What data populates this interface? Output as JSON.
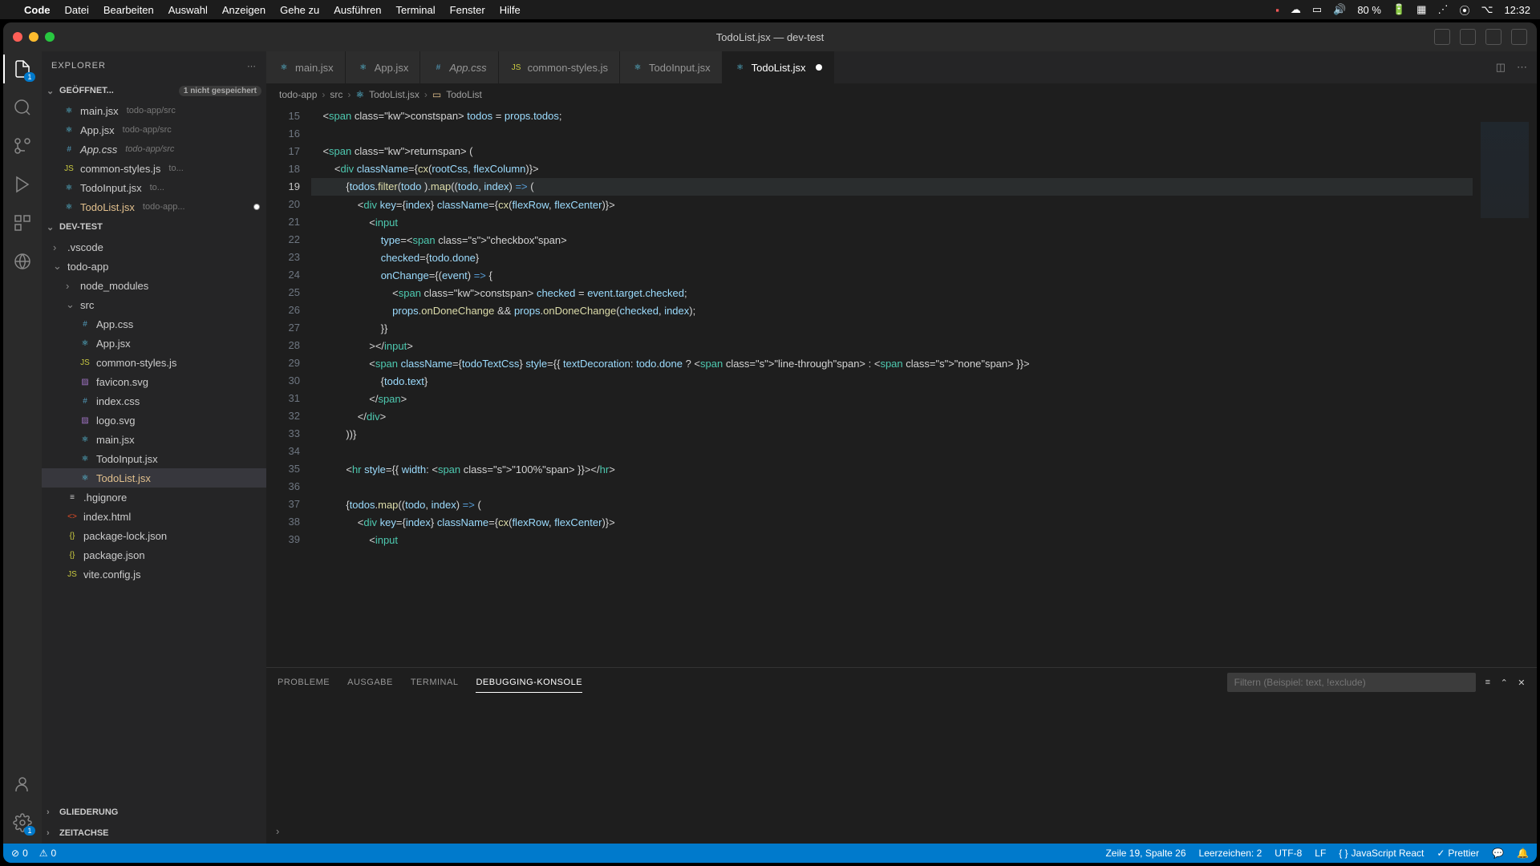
{
  "menubar": {
    "app": "Code",
    "items": [
      "Datei",
      "Bearbeiten",
      "Auswahl",
      "Anzeigen",
      "Gehe zu",
      "Ausführen",
      "Terminal",
      "Fenster",
      "Hilfe"
    ],
    "battery": "80 %",
    "time": "12:32"
  },
  "window": {
    "title": "TodoList.jsx — dev-test"
  },
  "sidebar": {
    "title": "EXPLORER",
    "openEditors": {
      "label": "GEÖFFNET...",
      "badge": "1 nicht gespeichert",
      "items": [
        {
          "name": "main.jsx",
          "path": "todo-app/src",
          "icon": "react"
        },
        {
          "name": "App.jsx",
          "path": "todo-app/src",
          "icon": "react"
        },
        {
          "name": "App.css",
          "path": "todo-app/src",
          "icon": "css",
          "italic": true
        },
        {
          "name": "common-styles.js",
          "path": "to...",
          "icon": "js"
        },
        {
          "name": "TodoInput.jsx",
          "path": "to...",
          "icon": "react"
        },
        {
          "name": "TodoList.jsx",
          "path": "todo-app...",
          "icon": "react",
          "modified": true
        }
      ]
    },
    "workspace": {
      "label": "DEV-TEST",
      "tree": [
        {
          "name": ".vscode",
          "type": "folder",
          "depth": 0
        },
        {
          "name": "todo-app",
          "type": "folder",
          "depth": 0,
          "open": true
        },
        {
          "name": "node_modules",
          "type": "folder",
          "depth": 1
        },
        {
          "name": "src",
          "type": "folder",
          "depth": 1,
          "open": true
        },
        {
          "name": "App.css",
          "type": "file",
          "icon": "css",
          "depth": 2
        },
        {
          "name": "App.jsx",
          "type": "file",
          "icon": "react",
          "depth": 2
        },
        {
          "name": "common-styles.js",
          "type": "file",
          "icon": "js",
          "depth": 2
        },
        {
          "name": "favicon.svg",
          "type": "file",
          "icon": "svg",
          "depth": 2
        },
        {
          "name": "index.css",
          "type": "file",
          "icon": "css",
          "depth": 2
        },
        {
          "name": "logo.svg",
          "type": "file",
          "icon": "svg",
          "depth": 2
        },
        {
          "name": "main.jsx",
          "type": "file",
          "icon": "react",
          "depth": 2
        },
        {
          "name": "TodoInput.jsx",
          "type": "file",
          "icon": "react",
          "depth": 2
        },
        {
          "name": "TodoList.jsx",
          "type": "file",
          "icon": "react",
          "depth": 2,
          "selected": true,
          "modified": true
        },
        {
          "name": ".hgignore",
          "type": "file",
          "icon": "txt",
          "depth": 1
        },
        {
          "name": "index.html",
          "type": "file",
          "icon": "html",
          "depth": 1
        },
        {
          "name": "package-lock.json",
          "type": "file",
          "icon": "json",
          "depth": 1
        },
        {
          "name": "package.json",
          "type": "file",
          "icon": "json",
          "depth": 1
        },
        {
          "name": "vite.config.js",
          "type": "file",
          "icon": "js",
          "depth": 1
        }
      ]
    },
    "outline": "GLIEDERUNG",
    "timeline": "ZEITACHSE"
  },
  "tabs": [
    {
      "name": "main.jsx",
      "icon": "react"
    },
    {
      "name": "App.jsx",
      "icon": "react"
    },
    {
      "name": "App.css",
      "icon": "css",
      "italic": true
    },
    {
      "name": "common-styles.js",
      "icon": "js"
    },
    {
      "name": "TodoInput.jsx",
      "icon": "react"
    },
    {
      "name": "TodoList.jsx",
      "icon": "react",
      "active": true,
      "modified": true
    }
  ],
  "breadcrumb": [
    "todo-app",
    "src",
    "TodoList.jsx",
    "TodoList"
  ],
  "code": {
    "startLine": 15,
    "lines": [
      "    const todos = props.todos;",
      "",
      "    return (",
      "        <div className={cx(rootCss, flexColumn)}>",
      "            {todos.filter(todo ).map((todo, index) => (",
      "                <div key={index} className={cx(flexRow, flexCenter)}>",
      "                    <input",
      "                        type=\"checkbox\"",
      "                        checked={todo.done}",
      "                        onChange={(event) => {",
      "                            const checked = event.target.checked;",
      "                            props.onDoneChange && props.onDoneChange(checked, index);",
      "                        }}",
      "                    ></input>",
      "                    <span className={todoTextCss} style={{ textDecoration: todo.done ? \"line-through\" : \"none\" }}>",
      "                        {todo.text}",
      "                    </span>",
      "                </div>",
      "            ))}",
      "",
      "            <hr style={{ width: \"100%\" }}></hr>",
      "",
      "            {todos.map((todo, index) => (",
      "                <div key={index} className={cx(flexRow, flexCenter)}>",
      "                    <input"
    ],
    "currentLine": 19
  },
  "panel": {
    "tabs": [
      "PROBLEME",
      "AUSGABE",
      "TERMINAL",
      "DEBUGGING-KONSOLE"
    ],
    "active": 3,
    "filterPlaceholder": "Filtern (Beispiel: text, !exclude)"
  },
  "statusbar": {
    "errors": "0",
    "warnings": "0",
    "position": "Zeile 19, Spalte 26",
    "spaces": "Leerzeichen: 2",
    "encoding": "UTF-8",
    "eol": "LF",
    "lang": "JavaScript React",
    "prettier": "Prettier"
  },
  "activity": {
    "explorerBadge": "1",
    "settingsBadge": "1"
  }
}
